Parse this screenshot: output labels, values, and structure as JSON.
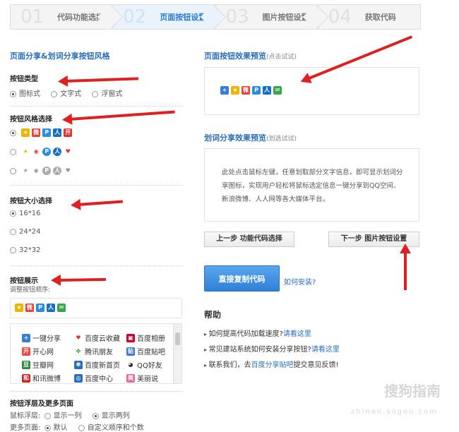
{
  "steps": [
    {
      "num": "01",
      "label": "代码功能选择",
      "active": false
    },
    {
      "num": "02",
      "label": "页面按钮设置",
      "active": true
    },
    {
      "num": "03",
      "label": "图片按钮设置",
      "active": false
    },
    {
      "num": "04",
      "label": "获取代码",
      "active": false
    }
  ],
  "left": {
    "title": "页面分享&划词分享按钮风格",
    "btn_type": {
      "title": "按钮类型",
      "options": [
        "图标式",
        "文字式",
        "浮窗式"
      ],
      "selected": 0
    },
    "btn_style": {
      "title": "按钮风格选择"
    },
    "btn_size": {
      "title": "按钮大小选择",
      "options": [
        "16*16",
        "24*24",
        "32*32"
      ],
      "selected": 0
    },
    "btn_display": {
      "title": "按钮展示",
      "subtitle": "调整按钮顺序:"
    },
    "services": [
      [
        "一键分享",
        "百度云收藏",
        "百度相册"
      ],
      [
        "开心网",
        "腾讯朋友",
        "百度贴吧"
      ],
      [
        "豆瓣网",
        "百度新首页",
        "QQ好友"
      ],
      [
        "和讯微博",
        "百度中心",
        "美丽说"
      ]
    ],
    "float_layer": {
      "title": "按钮浮层及更多页面",
      "row1_label": "鼠标浮层:",
      "row1_opts": [
        "显示一列",
        "显示两列"
      ],
      "row2_label": "更多页面:",
      "row2_opts": [
        "默认",
        "自定义顺序和个数"
      ]
    }
  },
  "right": {
    "preview_title": "页面按钮效果预览",
    "preview_hint": "(点击试试)",
    "huaci_title": "划词分享效果预览",
    "huaci_hint": "(划选试试)",
    "huaci_text": "此处点击鼠标左键，任意划取部分文字信息，即可显示划词分享图标，实现用户轻松将鼠标选定信息一键分享到QQ空间、新浪微博、人人网等各大媒体平台。",
    "prev_btn": "上一步 功能代码选择",
    "next_btn": "下一步 图片按钮设置",
    "copy_btn": "直接复制代码",
    "install_link": "如何安装?",
    "help_title": "帮助",
    "help_items": [
      {
        "text": "如何提高代码加载速度?",
        "link": "请看这里",
        "after": ""
      },
      {
        "text": "常见建站系统如何安装分享按钮?",
        "link": "请看这里",
        "after": ""
      },
      {
        "text": "联系我们，去",
        "link": "百度分享贴吧",
        "after": "提交意见反馈!"
      }
    ]
  },
  "watermark": {
    "main": "搜狗指南",
    "sub": "zhinan.sogou.com"
  },
  "colors": {
    "accent": "#2a6ebd",
    "arrow": "#e02020",
    "copy_btn": "#2f80d8"
  }
}
